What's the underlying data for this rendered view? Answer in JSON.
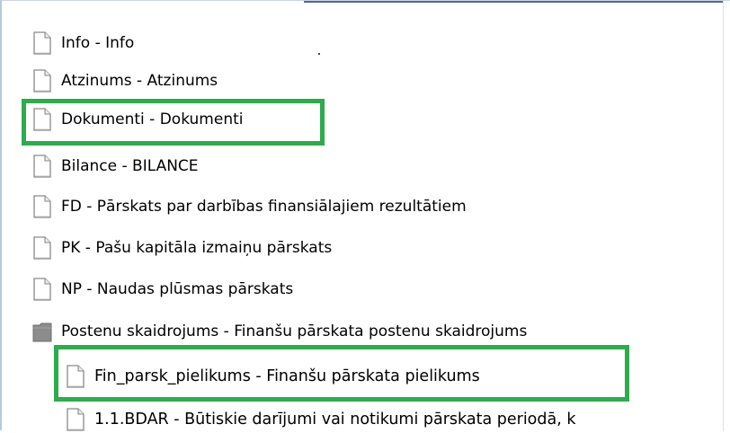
{
  "tree": {
    "items": [
      {
        "label": "Info - Info",
        "icon": "document-icon"
      },
      {
        "label": "Atzinums - Atzinums",
        "icon": "document-icon"
      },
      {
        "label": "Dokumenti - Dokumenti",
        "icon": "document-icon",
        "highlighted": true
      },
      {
        "label": "Bilance - BILANCE",
        "icon": "document-icon"
      },
      {
        "label": "FD - Pārskats par darbības finansiālajiem rezultātiem",
        "icon": "document-icon"
      },
      {
        "label": "PK - Pašu kapitāla izmaiņu pārskats",
        "icon": "document-icon"
      },
      {
        "label": "NP - Naudas plūsmas pārskats",
        "icon": "document-icon"
      },
      {
        "label": "Postenu skaidrojums - Finanšu pārskata postenu skaidrojums",
        "icon": "folder-icon"
      },
      {
        "label": "Fin_parsk_pielikums - Finanšu pārskata pielikums",
        "icon": "document-icon",
        "highlighted": true
      },
      {
        "label": "1.1.BDAR - Būtiskie darījumi vai notikumi pārskata periodā, k",
        "icon": "document-icon"
      }
    ]
  },
  "colors": {
    "highlight": "#2eab4c",
    "text": "#000000",
    "icon_outline": "#8a8a8a",
    "folder_fill": "#8c8c8c"
  }
}
